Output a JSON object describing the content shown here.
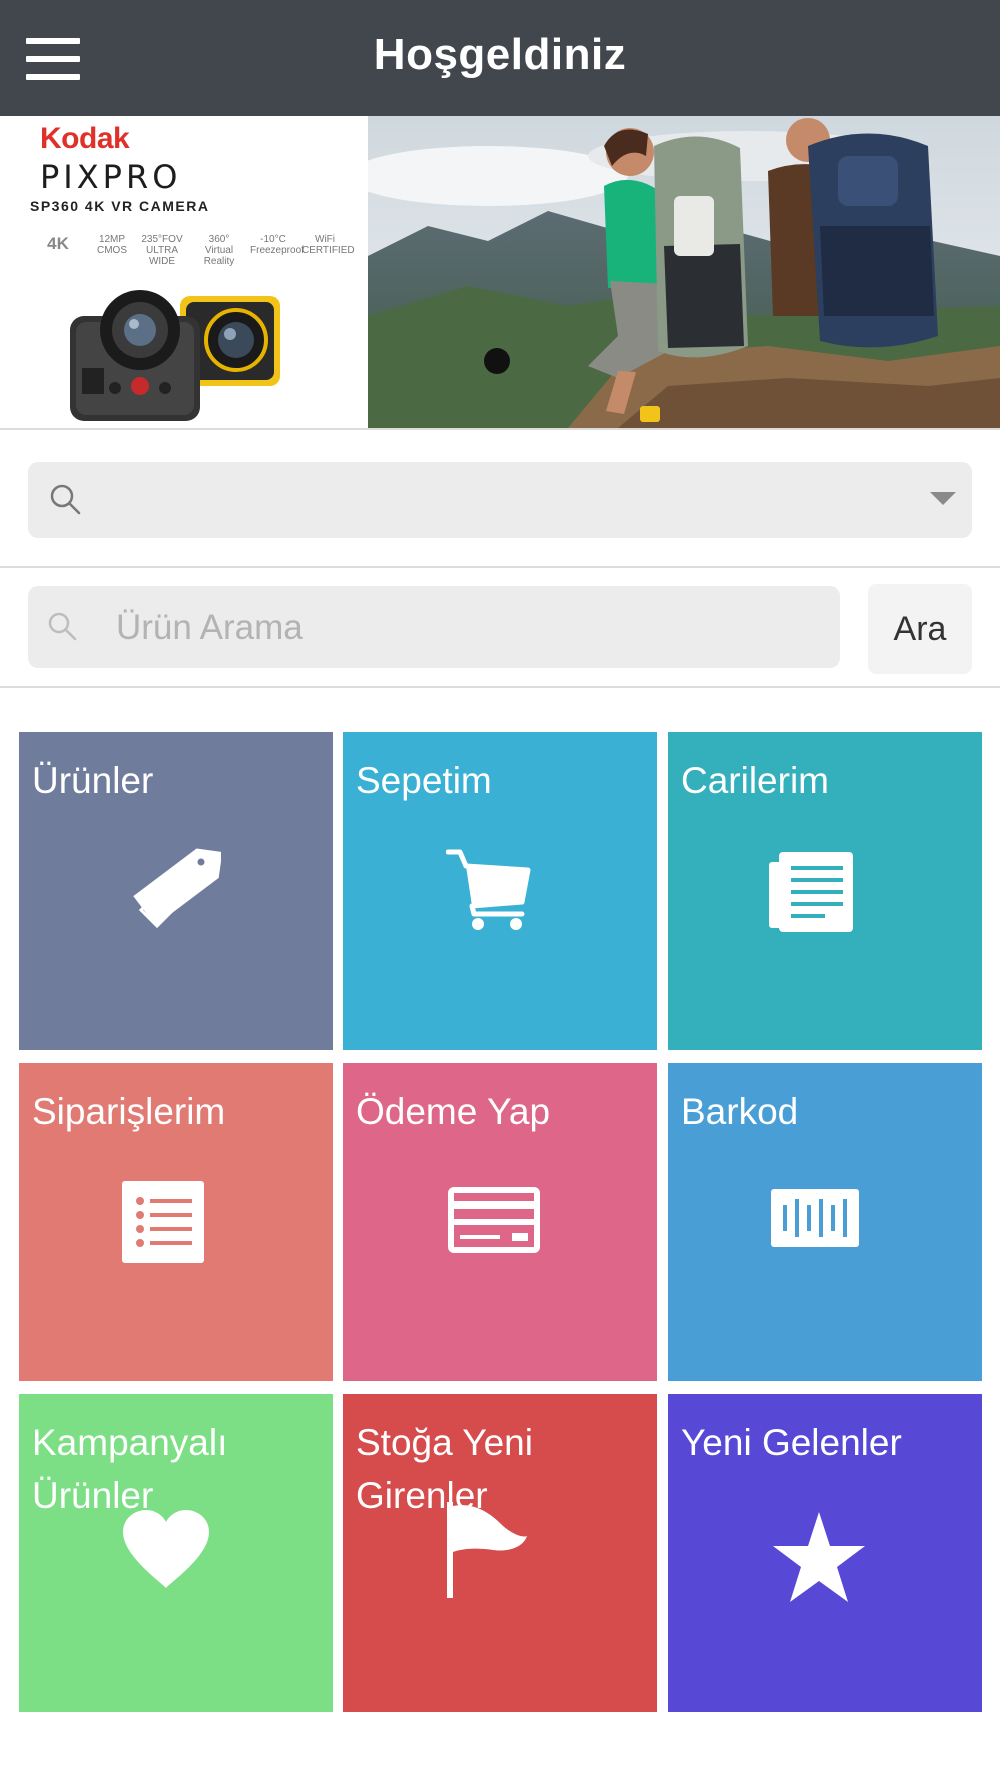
{
  "header": {
    "title": "Hoşgeldiniz",
    "menu_icon": "hamburger-menu-icon"
  },
  "banner": {
    "brand_top": "Kodak",
    "brand_name": "PIXPRO",
    "model": "SP360 4K VR CAMERA",
    "features": [
      "4K",
      "12MP CMOS",
      "235°FOV ULTRA WIDE",
      "360° Virtual Reality",
      "-10°C Freezeproof",
      "WiFi CERTIFIED"
    ],
    "active_slide": 1
  },
  "selector": {
    "value": "",
    "icon": "search-icon",
    "caret_icon": "chevron-down-icon"
  },
  "search": {
    "placeholder": "Ürün Arama",
    "value": "",
    "button_label": "Ara",
    "icon": "search-icon"
  },
  "tiles": [
    {
      "label": "Ürünler",
      "icon": "tag-icon",
      "color": "#6f7c9b"
    },
    {
      "label": "Sepetim",
      "icon": "shopping-cart-icon",
      "color": "#3ab0d5"
    },
    {
      "label": "Carilerim",
      "icon": "newspaper-icon",
      "color": "#33b0bb"
    },
    {
      "label": "Siparişlerim",
      "icon": "list-icon",
      "color": "#e07a73"
    },
    {
      "label": "Ödeme Yap",
      "icon": "credit-card-icon",
      "color": "#de6688"
    },
    {
      "label": "Barkod",
      "icon": "barcode-icon",
      "color": "#499ed6"
    },
    {
      "label": "Kampanyalı Ürünler",
      "icon": "heart-icon",
      "color": "#7ddf85"
    },
    {
      "label": "Stoğa Yeni Girenler",
      "icon": "flag-icon",
      "color": "#d64b4c"
    },
    {
      "label": "Yeni Gelenler",
      "icon": "star-icon",
      "color": "#5749d6"
    }
  ]
}
